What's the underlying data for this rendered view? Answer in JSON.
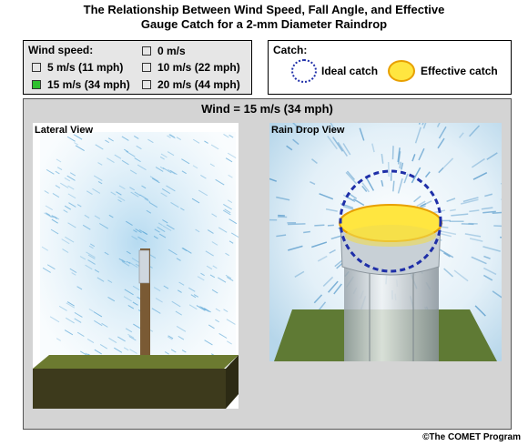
{
  "title": {
    "line1": "The Relationship Between Wind Speed, Fall Angle, and Effective",
    "line2": "Gauge Catch for a 2-mm Diameter Raindrop"
  },
  "wind_speed": {
    "heading": "Wind speed:",
    "options": [
      {
        "label": "0 m/s",
        "selected": false
      },
      {
        "label": "5 m/s (11 mph)",
        "selected": false
      },
      {
        "label": "10 m/s (22 mph)",
        "selected": false
      },
      {
        "label": "15 m/s (34 mph)",
        "selected": true
      },
      {
        "label": "20 m/s (44 mph)",
        "selected": false
      }
    ]
  },
  "catch_legend": {
    "heading": "Catch:",
    "ideal": "Ideal catch",
    "effective": "Effective catch"
  },
  "display": {
    "wind_label": "Wind = 15 m/s (34 mph)",
    "lateral_title": "Lateral View",
    "drop_title": "Rain Drop View"
  },
  "colors": {
    "selected_checkbox": "#2ec02e",
    "ideal_circle": "#1f2fa8",
    "effective_fill": "#ffe640",
    "effective_ring": "#e8a000",
    "rain": "#8fc7e8",
    "ground": "#5a6a28"
  },
  "copyright": "©The COMET Program"
}
